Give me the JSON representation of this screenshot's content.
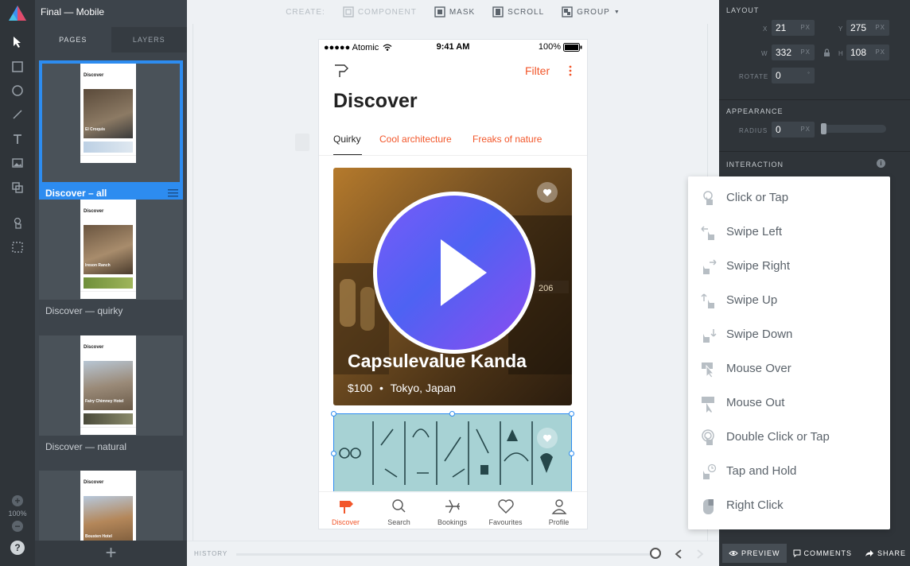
{
  "app": {
    "project_title": "Final — Mobile"
  },
  "left_tabs": {
    "pages": "PAGES",
    "layers": "LAYERS"
  },
  "pages": [
    {
      "label": "Discover – all",
      "selected": true,
      "thumb_title": "Discover",
      "thumb_card": "El Croquis"
    },
    {
      "label": "Discover — quirky",
      "selected": false,
      "thumb_title": "Discover",
      "thumb_card": "Ireson Ranch"
    },
    {
      "label": "Discover — natural",
      "selected": false,
      "thumb_title": "Discover",
      "thumb_card": "Fairy Chimney Hotel"
    },
    {
      "label": "",
      "selected": false,
      "thumb_title": "Discover",
      "thumb_card": "Bousten Hotel"
    }
  ],
  "zoom": {
    "level": "100%"
  },
  "canvas_toolbar": {
    "create": "CREATE:",
    "component": "COMPONENT",
    "mask": "MASK",
    "scroll": "SCROLL",
    "group": "GROUP"
  },
  "history": {
    "label": "HISTORY"
  },
  "phone": {
    "carrier": "●●●●● Atomic",
    "time": "9:41 AM",
    "battery": "100%",
    "filter": "Filter",
    "title": "Discover",
    "tabs": [
      "Quirky",
      "Cool architecture",
      "Freaks of nature"
    ],
    "card": {
      "name": "Capsulevalue Kanda",
      "price": "$100",
      "location": "Tokyo, Japan",
      "sign_number": "206"
    },
    "nav": [
      "Discover",
      "Search",
      "Bookings",
      "Favourites",
      "Profile"
    ]
  },
  "inspector": {
    "layout_title": "LAYOUT",
    "x": "21",
    "y": "275",
    "w": "332",
    "h": "108",
    "unit": "PX",
    "rotate_label": "ROTATE",
    "rotate": "0",
    "appearance_title": "APPEARANCE",
    "radius_label": "RADIUS",
    "radius": "0",
    "interaction_title": "INTERACTION",
    "labels": {
      "x": "X",
      "y": "Y",
      "w": "W",
      "h": "H"
    }
  },
  "interactions": [
    {
      "label": "Click or Tap",
      "icon": "tap-icon"
    },
    {
      "label": "Swipe Left",
      "icon": "swipe-left-icon"
    },
    {
      "label": "Swipe Right",
      "icon": "swipe-right-icon"
    },
    {
      "label": "Swipe Up",
      "icon": "swipe-up-icon"
    },
    {
      "label": "Swipe Down",
      "icon": "swipe-down-icon"
    },
    {
      "label": "Mouse Over",
      "icon": "mouse-over-icon"
    },
    {
      "label": "Mouse Out",
      "icon": "mouse-out-icon"
    },
    {
      "label": "Double Click or Tap",
      "icon": "double-tap-icon"
    },
    {
      "label": "Tap and Hold",
      "icon": "tap-hold-icon"
    },
    {
      "label": "Right Click",
      "icon": "right-click-icon"
    }
  ],
  "bottom_actions": {
    "preview": "PREVIEW",
    "comments": "COMMENTS",
    "share": "SHARE"
  },
  "colors": {
    "accent": "#f2562a",
    "selection": "#2d8cf0",
    "play_start": "#7a5af8",
    "play_end": "#8c4cf0"
  }
}
